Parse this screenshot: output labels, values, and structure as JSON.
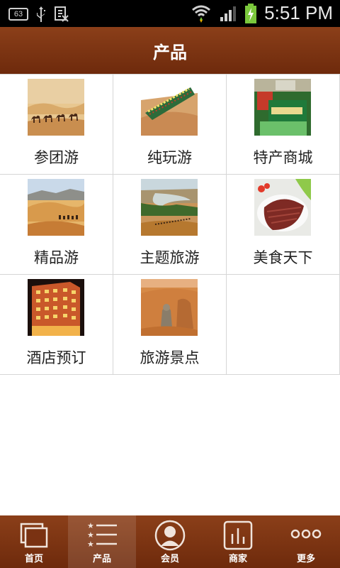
{
  "status_bar": {
    "notification_count": "63",
    "time": "5:51 PM"
  },
  "header": {
    "title": "产品"
  },
  "products": [
    {
      "label": "参团游",
      "thumb": "camels-desert"
    },
    {
      "label": "纯玩游",
      "thumb": "sand-boat"
    },
    {
      "label": "特产商城",
      "thumb": "specialty-boxes"
    },
    {
      "label": "精品游",
      "thumb": "camel-caravan-dunes"
    },
    {
      "label": "主题旅游",
      "thumb": "river-valley"
    },
    {
      "label": "美食天下",
      "thumb": "sliced-meat"
    },
    {
      "label": "酒店预订",
      "thumb": "hotel-night"
    },
    {
      "label": "旅游景点",
      "thumb": "desert-statues"
    }
  ],
  "bottom_nav": {
    "items": [
      {
        "label": "首页",
        "icon": "home-icon",
        "active": false
      },
      {
        "label": "产品",
        "icon": "list-icon",
        "active": true
      },
      {
        "label": "会员",
        "icon": "user-icon",
        "active": false
      },
      {
        "label": "商家",
        "icon": "chart-icon",
        "active": false
      },
      {
        "label": "更多",
        "icon": "more-icon",
        "active": false
      }
    ]
  },
  "colors": {
    "brand": "#7a3212",
    "grid_line": "#d6d6d6"
  }
}
